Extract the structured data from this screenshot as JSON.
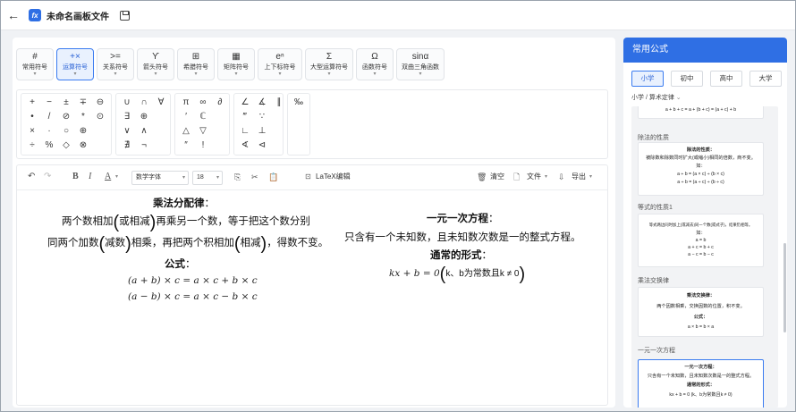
{
  "app": {
    "title": "未命名画板文件"
  },
  "tabs": [
    {
      "icon": "#",
      "label": "常用符号"
    },
    {
      "icon": "+×",
      "label": "运算符号"
    },
    {
      "icon": ">=",
      "label": "关系符号"
    },
    {
      "icon": "ϒ",
      "label": "箭头符号"
    },
    {
      "icon": "⊞",
      "label": "希腊符号"
    },
    {
      "icon": "▦",
      "label": "矩阵符号"
    },
    {
      "icon": "eⁿ",
      "label": "上下标符号"
    },
    {
      "icon": "Σ",
      "label": "大型运算符号"
    },
    {
      "icon": "Ω",
      "label": "函数符号"
    },
    {
      "icon": "sinα",
      "label": "双曲三角函数"
    }
  ],
  "symbols": {
    "g1": [
      "+",
      "−",
      "±",
      "∓",
      "⊖",
      "•",
      "/",
      "⊘",
      "*",
      "⊙",
      "×",
      "·",
      "○",
      "⊕",
      "",
      "÷",
      "%",
      "◇",
      "⊗",
      ""
    ],
    "g2": [
      "∪",
      "∩",
      "∀",
      "∃",
      "⊕",
      "",
      "∨",
      "∧",
      "",
      "∄",
      "¬",
      ""
    ],
    "g3": [
      "π",
      "∞",
      "∂",
      "′",
      "ℂ",
      "",
      "△",
      "▽",
      "",
      "″",
      "!",
      ""
    ],
    "g4": [
      "∠",
      "∡",
      "∥",
      "‴",
      "∵",
      "",
      "∟",
      "⊥",
      "",
      "∢",
      "⊲",
      ""
    ],
    "g5": [
      "‰"
    ]
  },
  "toolbar": {
    "font": "数学字体",
    "size": "18",
    "latex": "LaTeX编辑",
    "clear": "清空",
    "file": "文件",
    "export": "导出"
  },
  "canvas": {
    "left": {
      "title": "乘法分配律",
      "line1a": "两个数相加",
      "line1b": "或相减",
      "line1c": "再乘另一个数，等于把这个数分别",
      "line2a": "同两个加数",
      "line2b": "减数",
      "line2c": "相乘，再把两个积相加",
      "line2d": "相减",
      "line2e": "，得数不变。",
      "formula_label": "公式",
      "f1": "(a + b) × c = a × c + b × c",
      "f2": "(a − b) × c = a × c − b × c"
    },
    "right": {
      "title": "一元一次方程",
      "line1": "只含有一个未知数，且未知数次数是一的整式方程。",
      "form_label": "通常的形式",
      "f1": "kx + b = 0",
      "f1b": "k、b为常数且k ≠ 0"
    }
  },
  "panel": {
    "header": "常用公式",
    "levels": [
      "小学",
      "初中",
      "高中",
      "大学"
    ],
    "crumb": "小学 / 算术定律",
    "cards": [
      {
        "title": "",
        "lines": [
          "a + b + c = a + (b + c) = (a + c) + b"
        ]
      },
      {
        "title": "除法的性质",
        "lines": [
          "除法的性质：",
          "被除数和除数同时扩大(或缩小)相同的倍数，商不变。",
          "如：",
          "a ÷ b = (a × c) ÷ (b × c)",
          "a ÷ b = (a ÷ c) ÷ (b ÷ c)"
        ]
      },
      {
        "title": "等式的性质1",
        "lines": [
          "等式两边同时加上(或减去)同一个数(或式子)，结果仍相等。",
          "如：",
          "a = b",
          "a + c = b + c",
          "a − c = b − c"
        ]
      },
      {
        "title": "乘法交换律",
        "lines": [
          "乘法交换律：",
          "两个因数相乘，交换因数的位置，积不变。",
          "公式：",
          "a × b = b × a"
        ]
      },
      {
        "title": "一元一次方程",
        "lines": [
          "一元一次方程：",
          "只含有一个未知数，且未知数次数是一的整式方程。",
          "通常的形式：",
          "kx + b = 0 (k、b为常数且k ≠ 0)"
        ]
      }
    ]
  }
}
